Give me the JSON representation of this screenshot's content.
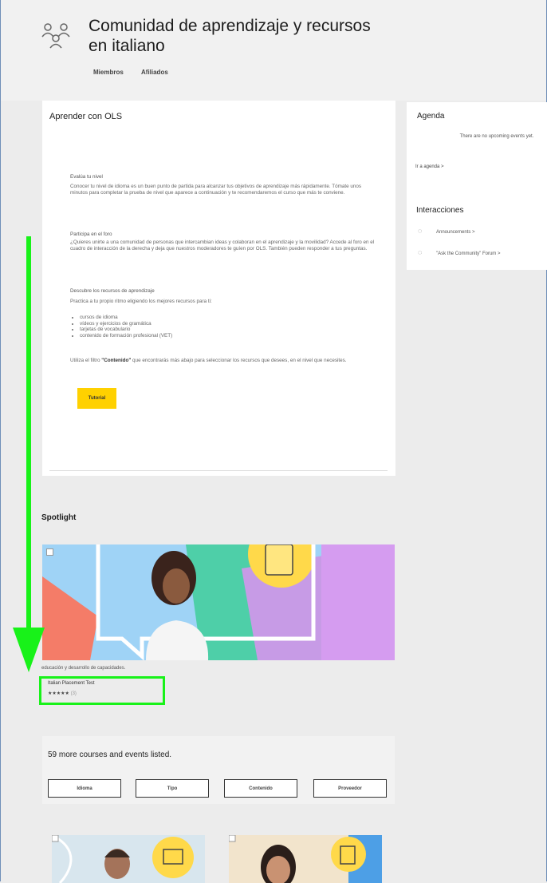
{
  "header": {
    "title": "Comunidad de aprendizaje y recursos en italiano",
    "subnav": [
      "Miembros",
      "Afiliados"
    ]
  },
  "main": {
    "title": "Aprender con OLS",
    "sections": [
      {
        "heading": "Evalúa tu nivel",
        "text": "Conocer tu nivel de idioma es un buen punto de partida para alcanzar tus objetivos de aprendizaje más rápidamente. Tómate unos minutos para completar la prueba de nivel que aparece a continuación y te recomendaremos el curso que más te conviene."
      },
      {
        "heading": "Participa en el foro",
        "text": "¿Quieres unirte a una comunidad de personas que intercambian ideas y colaboran en el aprendizaje y la movilidad? Accede al foro en el cuadro de interacción de la derecha y deja que nuestros moderadores te guíen por OLS. También pueden responder a tus preguntas."
      },
      {
        "heading": "Descubre los recursos de aprendizaje",
        "text": "Practica a tu propio ritmo eligiendo los mejores recursos para ti:"
      }
    ],
    "bullets": [
      "cursos de idioma",
      "vídeos y ejercicios de gramática",
      "tarjetas de vocabulario",
      "contenido de formación profesional (VET)"
    ],
    "filter_text_pre": "Utiliza el filtro ",
    "filter_word": "\"Contenido\"",
    "filter_text_post": " que encontrarás más abajo para seleccionar los recursos que desees, en el nivel que necesites.",
    "button_label": "Tutorial"
  },
  "sidebar": {
    "agenda_title": "Agenda",
    "agenda_text": "There are no upcoming events yet.",
    "agenda_link": "Ir a agenda",
    "interactions_title": "Interacciones",
    "items": [
      "Announcements",
      "\"Ask the Community\" Forum"
    ]
  },
  "spotlight": {
    "title": "Spotlight",
    "description": "educación y desarrollo de capacidades.",
    "item_title": "Italian Placement Test",
    "rating": "★★★★★",
    "rating_count": "(3)"
  },
  "more": {
    "title": "59 more courses and events listed.",
    "filters": [
      "Idioma",
      "Tipo",
      "Contenido",
      "Proveedor"
    ]
  },
  "colors": {
    "accent_yellow": "#ffd100",
    "highlight_green": "#18f219"
  }
}
